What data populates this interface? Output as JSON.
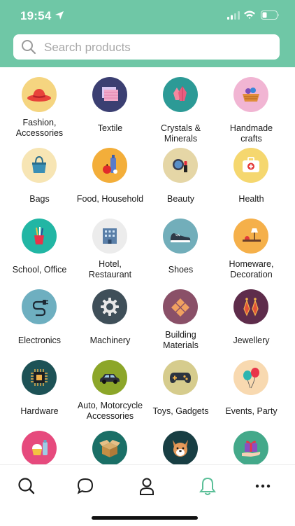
{
  "status_bar": {
    "time": "19:54"
  },
  "search": {
    "placeholder": "Search products",
    "icon": "search-icon"
  },
  "categories": [
    {
      "label": "Fashion,\nAccessories",
      "icon": "hat-icon",
      "bg": "#f5d580"
    },
    {
      "label": "Textile",
      "icon": "fabric-icon",
      "bg": "#3b3f72"
    },
    {
      "label": "Crystals &\nMinerals",
      "icon": "crystal-icon",
      "bg": "#2c9a96"
    },
    {
      "label": "Handmade\ncrafts",
      "icon": "basket-icon",
      "bg": "#f1b5d3"
    },
    {
      "label": "Bags",
      "icon": "bag-icon",
      "bg": "#f7e5b4"
    },
    {
      "label": "Food, Household",
      "icon": "food-bottles-icon",
      "bg": "#f3ae3a"
    },
    {
      "label": "Beauty",
      "icon": "cosmetics-icon",
      "bg": "#e5d6a6"
    },
    {
      "label": "Health",
      "icon": "first-aid-icon",
      "bg": "#f5d76f"
    },
    {
      "label": "School, Office",
      "icon": "pencil-cup-icon",
      "bg": "#22b6a4"
    },
    {
      "label": "Hotel,\nRestaurant",
      "icon": "building-icon",
      "bg": "#ececec"
    },
    {
      "label": "Shoes",
      "icon": "shoe-icon",
      "bg": "#72aeba"
    },
    {
      "label": "Homeware,\nDecoration",
      "icon": "lamp-icon",
      "bg": "#f5b04a"
    },
    {
      "label": "Electronics",
      "icon": "plug-icon",
      "bg": "#6eafc0"
    },
    {
      "label": "Machinery",
      "icon": "gear-icon",
      "bg": "#3f4f59"
    },
    {
      "label": "Building\nMaterials",
      "icon": "tiles-icon",
      "bg": "#8a5068"
    },
    {
      "label": "Jewellery",
      "icon": "earrings-icon",
      "bg": "#5e2c4b"
    },
    {
      "label": "Hardware",
      "icon": "chip-icon",
      "bg": "#1d5256"
    },
    {
      "label": "Auto, Motorcycle\nAccessories",
      "icon": "car-icon",
      "bg": "#8ca629"
    },
    {
      "label": "Toys, Gadgets",
      "icon": "gamepad-icon",
      "bg": "#d6cc8d"
    },
    {
      "label": "Events, Party",
      "icon": "balloons-icon",
      "bg": "#f8d9b0"
    },
    {
      "label": "",
      "icon": "cupcake-icon",
      "bg": "#e64a7d"
    },
    {
      "label": "",
      "icon": "box-icon",
      "bg": "#1a6f66"
    },
    {
      "label": "",
      "icon": "dog-icon",
      "bg": "#183e43"
    },
    {
      "label": "",
      "icon": "gift-icon",
      "bg": "#44a98a"
    }
  ],
  "tab_bar": [
    {
      "icon": "search-icon",
      "active": false
    },
    {
      "icon": "chat-bubble-icon",
      "active": false
    },
    {
      "icon": "user-icon",
      "active": false
    },
    {
      "icon": "bell-icon",
      "active": true
    },
    {
      "icon": "more-icon",
      "active": false
    }
  ],
  "colors": {
    "header": "#6fc7a6",
    "accent": "#5bbf98"
  }
}
